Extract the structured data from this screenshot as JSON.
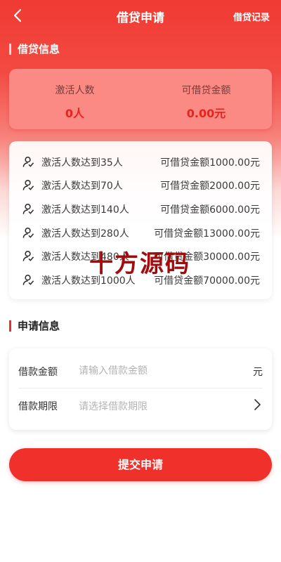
{
  "header": {
    "title": "借贷申请",
    "record_label": "借贷记录"
  },
  "loan_info": {
    "section_title": "借贷信息",
    "stats": [
      {
        "label": "激活人数",
        "value": "0人"
      },
      {
        "label": "可借贷金额",
        "value": "0.00元"
      }
    ],
    "tiers": [
      {
        "condition": "激活人数达到35人",
        "amount": "可借贷金额1000.00元"
      },
      {
        "condition": "激活人数达到70人",
        "amount": "可借贷金额2000.00元"
      },
      {
        "condition": "激活人数达到140人",
        "amount": "可借贷金额6000.00元"
      },
      {
        "condition": "激活人数达到280人",
        "amount": "可借贷金额13000.00元"
      },
      {
        "condition": "激活人数达到480人",
        "amount": "可借贷金额30000.00元"
      },
      {
        "condition": "激活人数达到1000人",
        "amount": "可借贷金额70000.00元"
      }
    ],
    "tier_icon": "user-check-icon"
  },
  "apply_info": {
    "section_title": "申请信息",
    "amount": {
      "label": "借款金额",
      "placeholder": "请输入借款金额",
      "unit": "元"
    },
    "period": {
      "label": "借款期限",
      "placeholder": "请选择借款期限"
    }
  },
  "submit_label": "提交申请",
  "watermark": "十方源码",
  "colors": {
    "accent": "#f0302a",
    "stat_value": "#e8231d"
  }
}
